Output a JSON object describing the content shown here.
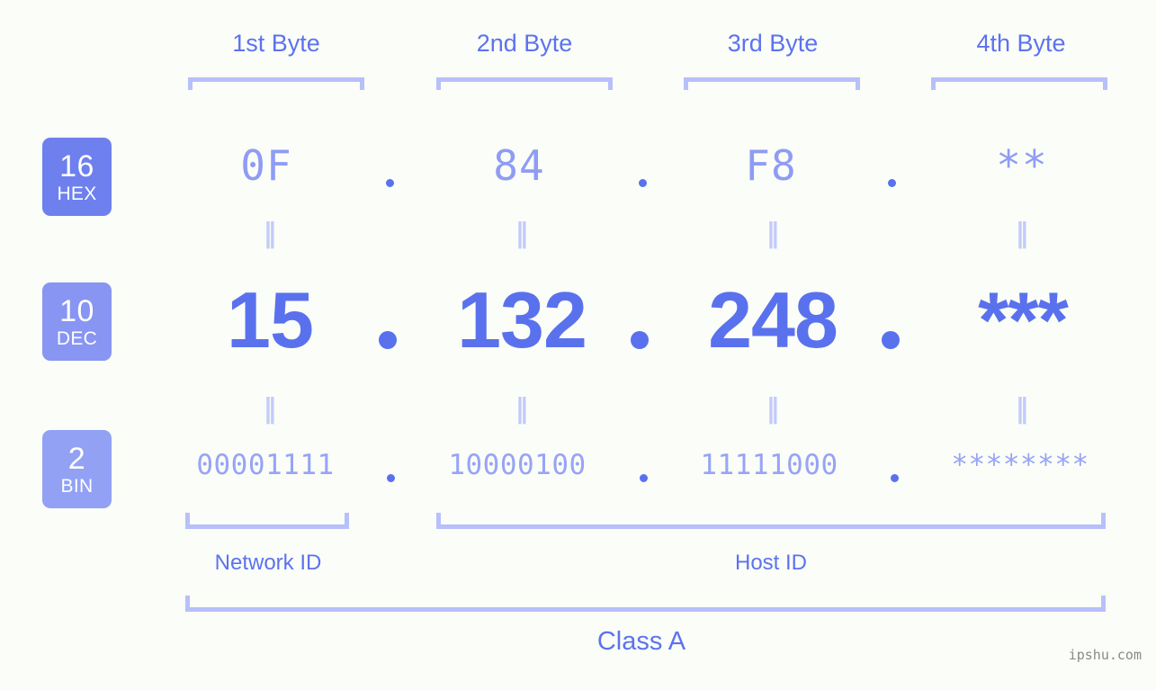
{
  "page": {
    "background_color": "#fbfdf8",
    "accent_color": "#5a71ee",
    "light_accent_color": "#b7c0fb",
    "watermark": "ipshu.com"
  },
  "byte_headers": [
    {
      "label": "1st Byte"
    },
    {
      "label": "2nd Byte"
    },
    {
      "label": "3rd Byte"
    },
    {
      "label": "4th Byte"
    }
  ],
  "bases": [
    {
      "number": "16",
      "name": "HEX",
      "color": "#6e80ee"
    },
    {
      "number": "10",
      "name": "DEC",
      "color": "#8895f2"
    },
    {
      "number": "2",
      "name": "BIN",
      "color": "#92a1f4"
    }
  ],
  "rows": {
    "hex": {
      "values": [
        "0F",
        "84",
        "F8",
        "**"
      ]
    },
    "dec": {
      "values": [
        "15",
        "132",
        "248",
        "***"
      ]
    },
    "bin": {
      "values": [
        "00001111",
        "10000100",
        "11111000",
        "********"
      ]
    }
  },
  "separator": ".",
  "equals_mark": "‖",
  "segments": {
    "network_id": "Network ID",
    "host_id": "Host ID",
    "class": "Class A"
  }
}
